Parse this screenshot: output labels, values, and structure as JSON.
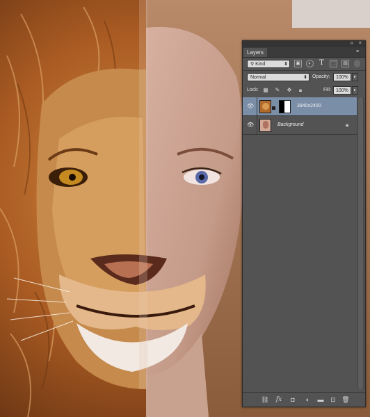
{
  "panel": {
    "tab_label": "Layers",
    "filter": {
      "value": "Kind"
    },
    "blend_mode": "Normal",
    "opacity_label": "Opacity:",
    "opacity_value": "100%",
    "lock_label": "Lock:",
    "fill_label": "Fill:",
    "fill_value": "100%",
    "filter_icons": [
      "image-filter-icon",
      "adjustment-filter-icon",
      "type-filter-icon",
      "shape-filter-icon",
      "smart-object-filter-icon"
    ],
    "lock_icons": [
      "lock-transparent-icon",
      "lock-image-icon",
      "lock-position-icon",
      "lock-all-icon"
    ],
    "layers": [
      {
        "name": "3940x2400",
        "selected": true,
        "has_mask": true
      },
      {
        "name": "Background",
        "selected": false,
        "locked": true
      }
    ],
    "bottom_icons": [
      "link-icon",
      "fx-icon",
      "add-mask-icon",
      "adjustment-layer-icon",
      "new-group-icon",
      "new-layer-icon",
      "trash-icon"
    ]
  },
  "colors": {
    "panel_bg": "#535353",
    "selected_layer": "#7a8ea8",
    "lion_fur": "#b5672a",
    "skin": "#c9a08e"
  }
}
